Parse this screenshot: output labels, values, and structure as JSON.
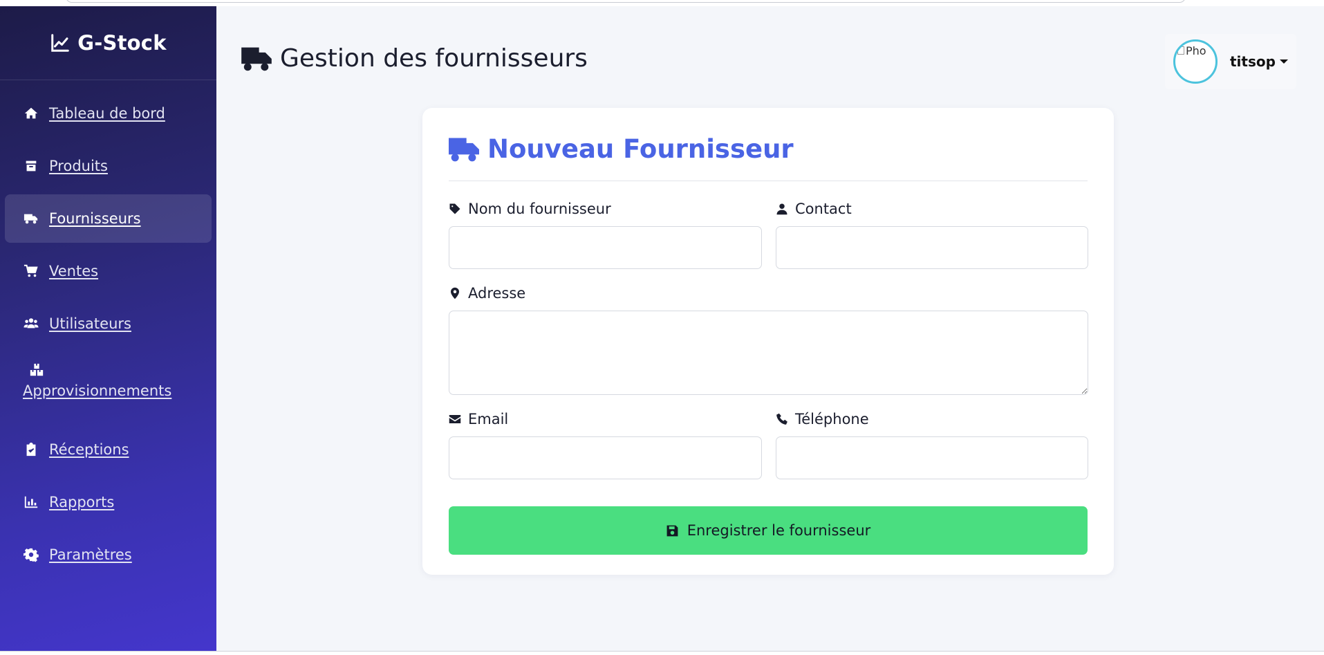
{
  "brand": {
    "name": "G-Stock",
    "icon": "chart-line-icon"
  },
  "sidebar": {
    "items": [
      {
        "label": " Tableau de bord",
        "icon": "home-icon",
        "active": false
      },
      {
        "label": " Produits",
        "icon": "box-icon",
        "active": false
      },
      {
        "label": " Fournisseurs",
        "icon": "truck-icon",
        "active": true
      },
      {
        "label": " Ventes",
        "icon": "cart-icon",
        "active": false
      },
      {
        "label": " Utilisateurs",
        "icon": "users-icon",
        "active": false
      },
      {
        "label": "Approvisionnements",
        "icon": "boxes-icon",
        "active": false
      },
      {
        "label": " Réceptions",
        "icon": "clipboard-check-icon",
        "active": false
      },
      {
        "label": " Rapports",
        "icon": "chart-bar-icon",
        "active": false
      },
      {
        "label": " Paramètres",
        "icon": "gear-icon",
        "active": false
      }
    ]
  },
  "header": {
    "title": "Gestion des fournisseurs",
    "icon": "truck-icon"
  },
  "user": {
    "name": "titsop",
    "avatar_alt": "Pho"
  },
  "form": {
    "title": "Nouveau Fournisseur",
    "fields": {
      "nom": {
        "label": "Nom du fournisseur",
        "value": "",
        "icon": "tag-icon"
      },
      "contact": {
        "label": "Contact",
        "value": "",
        "icon": "user-icon"
      },
      "adresse": {
        "label": "Adresse",
        "value": "",
        "icon": "map-marker-icon"
      },
      "email": {
        "label": "Email",
        "value": "",
        "icon": "envelope-icon"
      },
      "telephone": {
        "label": "Téléphone",
        "value": "",
        "icon": "phone-icon"
      }
    },
    "submit_label": "Enregistrer le fournisseur",
    "submit_icon": "save-icon"
  },
  "colors": {
    "sidebar_top": "#1d1b48",
    "sidebar_bottom": "#4436cc",
    "accent": "#4a64e4",
    "submit": "#4ade80",
    "avatar_ring": "#4cc3dd",
    "background": "#f4f6fa"
  }
}
